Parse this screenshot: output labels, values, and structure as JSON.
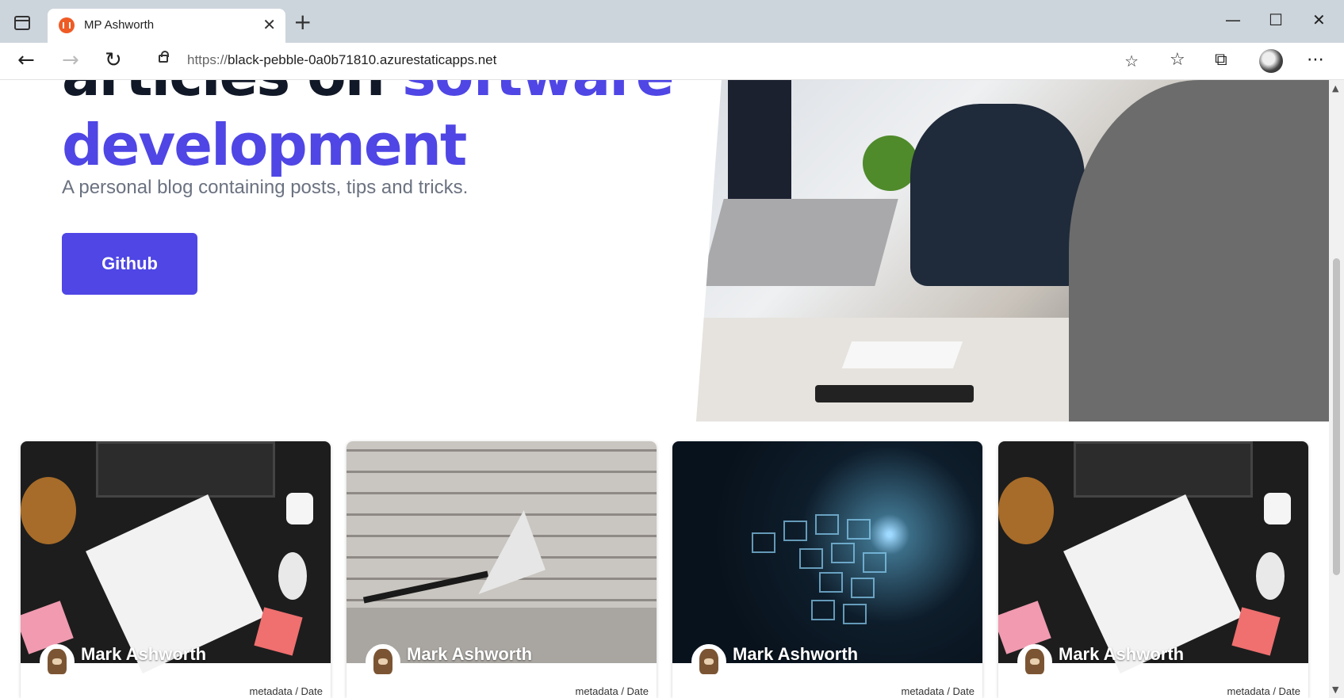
{
  "browser": {
    "tab_title": "MP Ashworth",
    "url_scheme": "https://",
    "url_host": "black-pebble-0a0b71810.azurestaticapps.net"
  },
  "hero": {
    "title_line1": "articles on ",
    "title_line1_accent": "software",
    "title_line2": "development",
    "subtitle": "A personal blog containing posts, tips and tricks.",
    "button_label": "Github"
  },
  "cards": [
    {
      "author": "Mark Ashworth",
      "meta": "metadata / Date",
      "image": "desk-sketch"
    },
    {
      "author": "Mark Ashworth",
      "meta": "metadata / Date",
      "image": "paper-plane-brick"
    },
    {
      "author": "Mark Ashworth",
      "meta": "metadata / Date",
      "image": "tech-cubes"
    },
    {
      "author": "Mark Ashworth",
      "meta": "metadata / Date",
      "image": "desk-sketch"
    }
  ],
  "colors": {
    "accent": "#4f46e5",
    "heading": "#111827",
    "subtitle": "#6b7280"
  }
}
